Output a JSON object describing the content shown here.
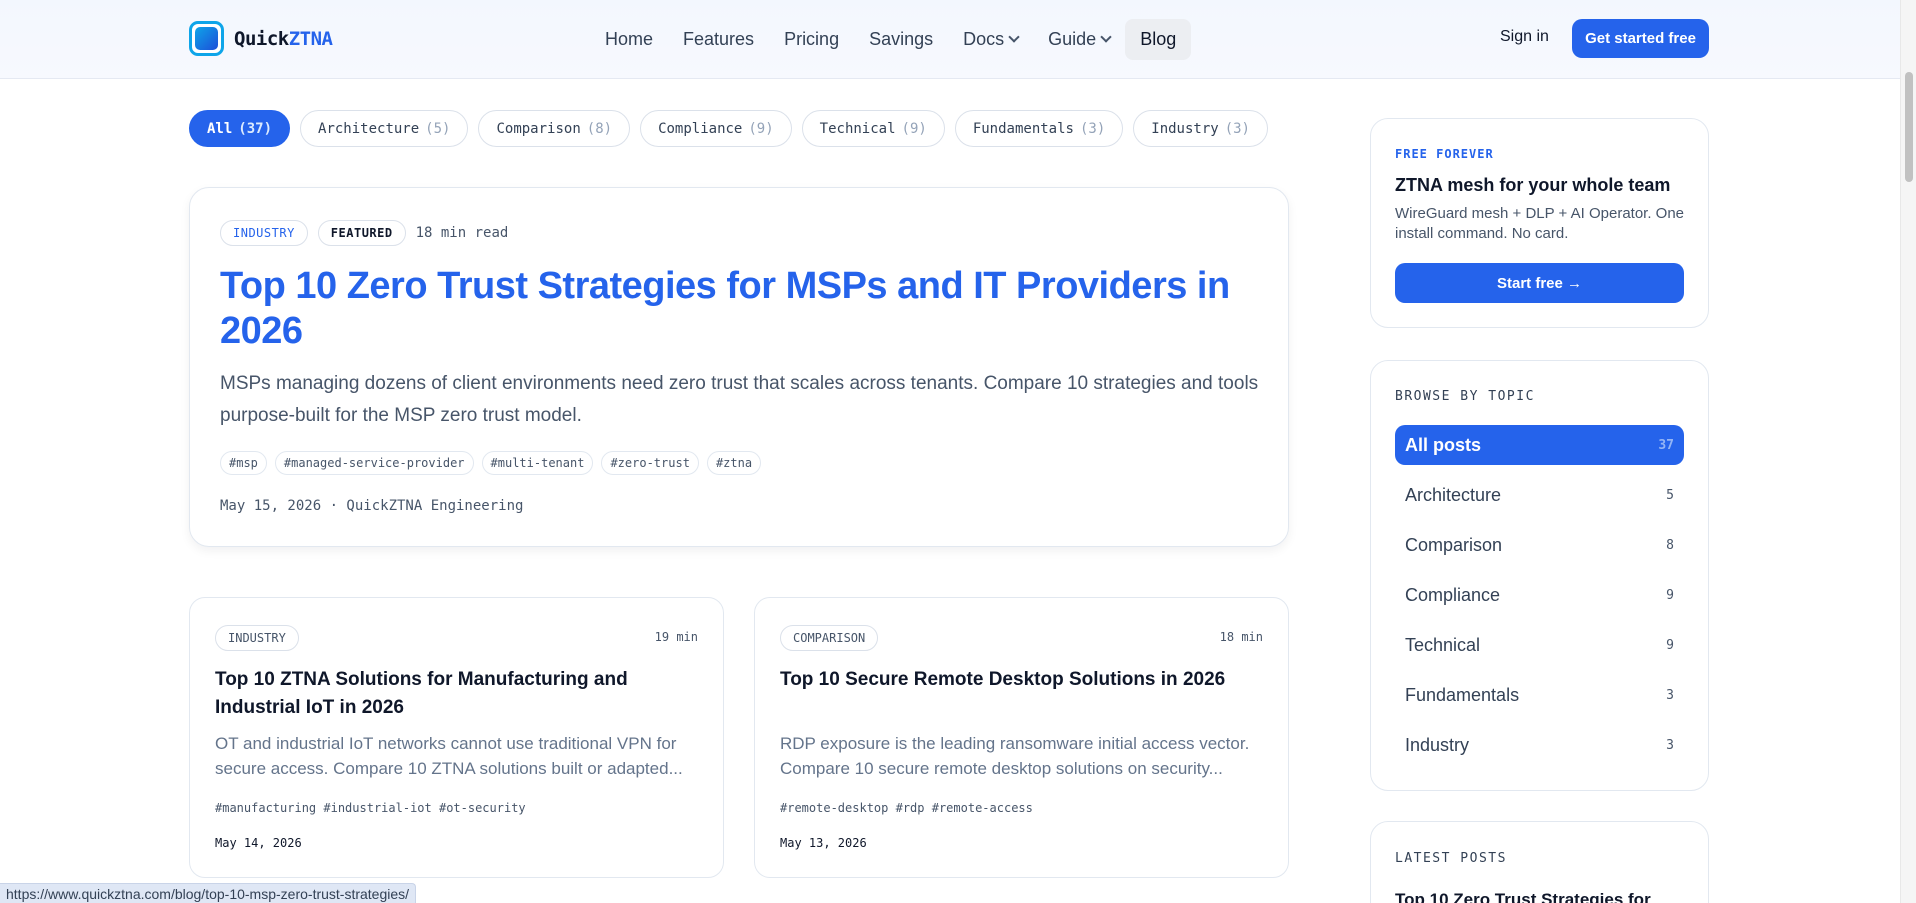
{
  "header": {
    "brand_a": "Quick",
    "brand_b": "ZTNA",
    "nav": {
      "home": "Home",
      "features": "Features",
      "pricing": "Pricing",
      "savings": "Savings",
      "docs": "Docs",
      "guide": "Guide",
      "blog": "Blog"
    },
    "signin": "Sign in",
    "cta": "Get started free"
  },
  "filters": [
    {
      "label": "All",
      "count": "(37)"
    },
    {
      "label": "Architecture",
      "count": "(5)"
    },
    {
      "label": "Comparison",
      "count": "(8)"
    },
    {
      "label": "Compliance",
      "count": "(9)"
    },
    {
      "label": "Technical",
      "count": "(9)"
    },
    {
      "label": "Fundamentals",
      "count": "(3)"
    },
    {
      "label": "Industry",
      "count": "(3)"
    }
  ],
  "featured": {
    "category": "INDUSTRY",
    "featured_label": "FEATURED",
    "read_time": "18 min read",
    "title": "Top 10 Zero Trust Strategies for MSPs and IT Providers in 2026",
    "excerpt": "MSPs managing dozens of client environments need zero trust that scales across tenants. Compare 10 strategies and tools purpose-built for the MSP zero trust model.",
    "tags": [
      "#msp",
      "#managed-service-provider",
      "#multi-tenant",
      "#zero-trust",
      "#ztna"
    ],
    "footer": "May 15, 2026 · QuickZTNA Engineering"
  },
  "cards": [
    {
      "category": "INDUSTRY",
      "minutes": "19 min",
      "title": "Top 10 ZTNA Solutions for Manufacturing and Industrial IoT in 2026",
      "excerpt": "OT and industrial IoT networks cannot use traditional VPN for secure access. Compare 10 ZTNA solutions built or adapted...",
      "tags": "#manufacturing #industrial-iot #ot-security",
      "date": "May 14, 2026"
    },
    {
      "category": "COMPARISON",
      "minutes": "18 min",
      "title": "Top 10 Secure Remote Desktop Solutions in 2026",
      "excerpt": "RDP exposure is the leading ransomware initial access vector. Compare 10 secure remote desktop solutions on security...",
      "tags": "#remote-desktop #rdp #remote-access",
      "date": "May 13, 2026"
    }
  ],
  "sidebar": {
    "promo": {
      "eyebrow": "FREE FOREVER",
      "title": "ZTNA mesh for your whole team",
      "desc": "WireGuard mesh + DLP + AI Operator. One install command. No card.",
      "button": "Start free →"
    },
    "topics": {
      "eyebrow": "BROWSE BY TOPIC",
      "items": [
        {
          "label": "All posts",
          "count": "37"
        },
        {
          "label": "Architecture",
          "count": "5"
        },
        {
          "label": "Comparison",
          "count": "8"
        },
        {
          "label": "Compliance",
          "count": "9"
        },
        {
          "label": "Technical",
          "count": "9"
        },
        {
          "label": "Fundamentals",
          "count": "3"
        },
        {
          "label": "Industry",
          "count": "3"
        }
      ]
    },
    "latest": {
      "eyebrow": "LATEST POSTS",
      "first": "Top 10 Zero Trust Strategies for"
    }
  },
  "status_url": "https://www.quickztna.com/blog/top-10-msp-zero-trust-strategies/",
  "colors": {
    "accent": "#2563eb",
    "logo": "#0ea5e9"
  }
}
